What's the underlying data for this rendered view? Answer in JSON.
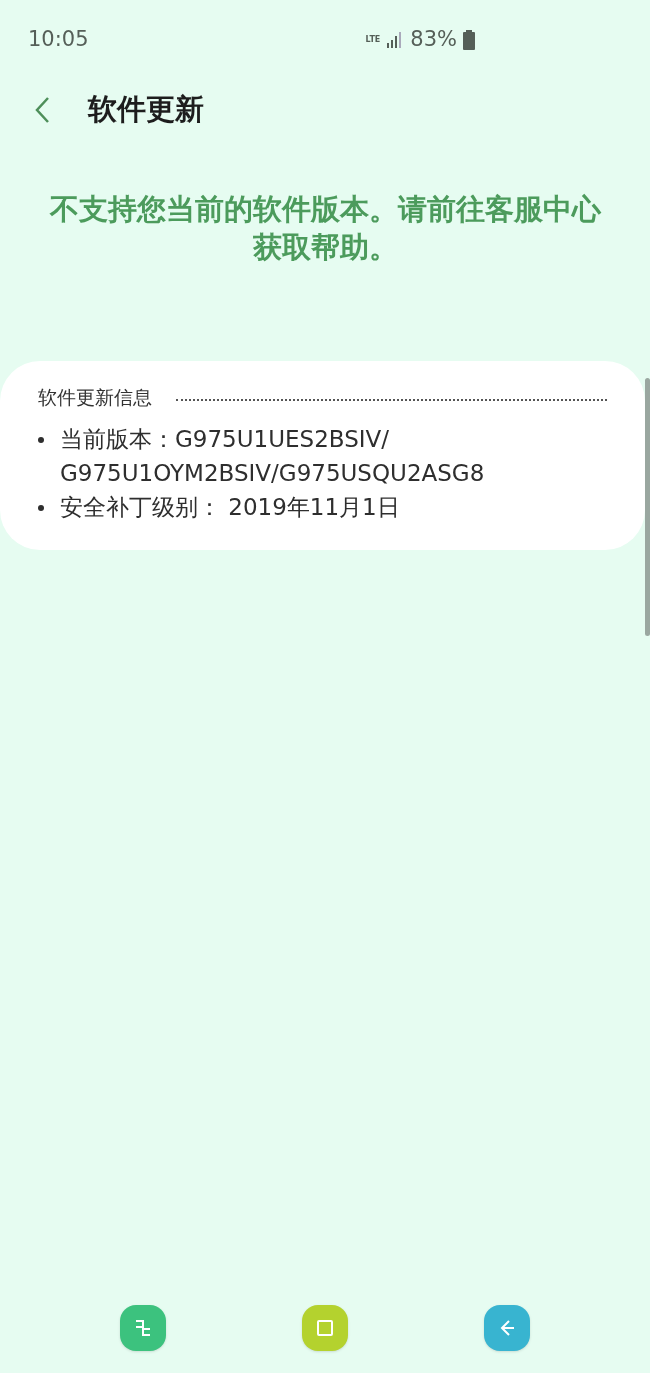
{
  "status_bar": {
    "time": "10:05",
    "network": "LTE",
    "battery": "83%"
  },
  "header": {
    "title": "软件更新"
  },
  "message": "不支持您当前的软件版本。请前往客服中心获取帮助。",
  "info_card": {
    "title": "软件更新信息",
    "items": [
      "当前版本：G975U1UES2BSIV/ G975U1OYM2BSIV/G975USQU2ASG8",
      "安全补丁级别： 2019年11月1日"
    ]
  },
  "nav_bar": [
    {
      "kind": "recent"
    },
    {
      "kind": "home"
    },
    {
      "kind": "back"
    }
  ]
}
